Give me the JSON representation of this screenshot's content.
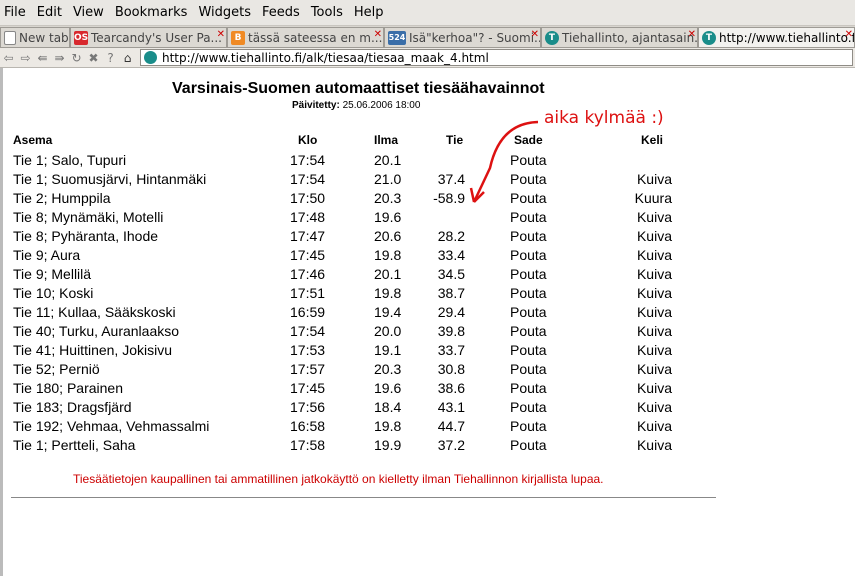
{
  "menu": [
    {
      "label": "File"
    },
    {
      "label": "Edit"
    },
    {
      "label": "View"
    },
    {
      "label": "Bookmarks"
    },
    {
      "label": "Widgets"
    },
    {
      "label": "Feeds"
    },
    {
      "label": "Tools"
    },
    {
      "label": "Help"
    }
  ],
  "tabs": [
    {
      "label": "New tab",
      "icon": "document-icon",
      "icon_color": "#ffffff",
      "active": false
    },
    {
      "label": "Tearcandy's User Pa...",
      "icon": "site-icon",
      "icon_color": "#d8282d",
      "active": false
    },
    {
      "label": "tässä sateessa en m...",
      "icon": "blogger-icon",
      "icon_color": "#f08a24",
      "active": false
    },
    {
      "label": "Isä\"kerhoa\"? - Suomi...",
      "icon": "site-icon",
      "icon_color": "#3a6ea8",
      "active": false
    },
    {
      "label": "Tiehallinto, ajantasain...",
      "icon": "tiehallinto-icon",
      "icon_color": "#1a8d8a",
      "active": false
    },
    {
      "label": "http://www.tiehallinto.fi...",
      "icon": "tiehallinto-icon",
      "icon_color": "#1a8d8a",
      "active": true
    }
  ],
  "address": {
    "url": "http://www.tiehallinto.fi/alk/tiesaa/tiesaa_maak_4.html"
  },
  "page": {
    "title": "Varsinais-Suomen automaattiset tiesäähavainnot",
    "updated_label": "Päivitetty:",
    "updated_value": "25.06.2006 18:00",
    "columns": [
      "Asema",
      "Klo",
      "Ilma",
      "Tie",
      "Sade",
      "Keli"
    ],
    "rows": [
      {
        "asema": "Tie 1; Salo, Tupuri",
        "klo": "17:54",
        "ilma": "20.1",
        "tie": "",
        "sade": "Pouta",
        "keli": ""
      },
      {
        "asema": "Tie 1; Suomusjärvi, Hintanmäki",
        "klo": "17:54",
        "ilma": "21.0",
        "tie": "37.4",
        "sade": "Pouta",
        "keli": "Kuiva"
      },
      {
        "asema": "Tie 2; Humppila",
        "klo": "17:50",
        "ilma": "20.3",
        "tie": "-58.9",
        "sade": "Pouta",
        "keli": "Kuura"
      },
      {
        "asema": "Tie 8; Mynämäki, Motelli",
        "klo": "17:48",
        "ilma": "19.6",
        "tie": "",
        "sade": "Pouta",
        "keli": "Kuiva"
      },
      {
        "asema": "Tie 8; Pyhäranta, Ihode",
        "klo": "17:47",
        "ilma": "20.6",
        "tie": "28.2",
        "sade": "Pouta",
        "keli": "Kuiva"
      },
      {
        "asema": "Tie 9; Aura",
        "klo": "17:45",
        "ilma": "19.8",
        "tie": "33.4",
        "sade": "Pouta",
        "keli": "Kuiva"
      },
      {
        "asema": "Tie 9; Mellilä",
        "klo": "17:46",
        "ilma": "20.1",
        "tie": "34.5",
        "sade": "Pouta",
        "keli": "Kuiva"
      },
      {
        "asema": "Tie 10; Koski",
        "klo": "17:51",
        "ilma": "19.8",
        "tie": "38.7",
        "sade": "Pouta",
        "keli": "Kuiva"
      },
      {
        "asema": "Tie 11; Kullaa, Sääkskoski",
        "klo": "16:59",
        "ilma": "19.4",
        "tie": "29.4",
        "sade": "Pouta",
        "keli": "Kuiva"
      },
      {
        "asema": "Tie 40; Turku, Auranlaakso",
        "klo": "17:54",
        "ilma": "20.0",
        "tie": "39.8",
        "sade": "Pouta",
        "keli": "Kuiva"
      },
      {
        "asema": "Tie 41; Huittinen, Jokisivu",
        "klo": "17:53",
        "ilma": "19.1",
        "tie": "33.7",
        "sade": "Pouta",
        "keli": "Kuiva"
      },
      {
        "asema": "Tie 52; Perniö",
        "klo": "17:57",
        "ilma": "20.3",
        "tie": "30.8",
        "sade": "Pouta",
        "keli": "Kuiva"
      },
      {
        "asema": "Tie 180; Parainen",
        "klo": "17:45",
        "ilma": "19.6",
        "tie": "38.6",
        "sade": "Pouta",
        "keli": "Kuiva"
      },
      {
        "asema": "Tie 183; Dragsfjärd",
        "klo": "17:56",
        "ilma": "18.4",
        "tie": "43.1",
        "sade": "Pouta",
        "keli": "Kuiva"
      },
      {
        "asema": "Tie 192; Vehmaa, Vehmassalmi",
        "klo": "16:58",
        "ilma": "19.8",
        "tie": "44.7",
        "sade": "Pouta",
        "keli": "Kuiva"
      },
      {
        "asema": "Tie 1; Pertteli, Saha",
        "klo": "17:58",
        "ilma": "19.9",
        "tie": "37.2",
        "sade": "Pouta",
        "keli": "Kuiva"
      }
    ],
    "footer": "Tiesäätietojen kaupallinen tai ammatillinen jatkokäyttö on kielletty ilman Tiehallinnon kirjallista lupaa."
  },
  "annotation": {
    "text": "aika kylmää :)",
    "color": "#dd1111"
  },
  "nav_icons": [
    "back-icon",
    "forward-icon",
    "rewind-icon",
    "fast-forward-icon",
    "reload-icon",
    "stop-icon",
    "wand-icon",
    "home-icon"
  ]
}
